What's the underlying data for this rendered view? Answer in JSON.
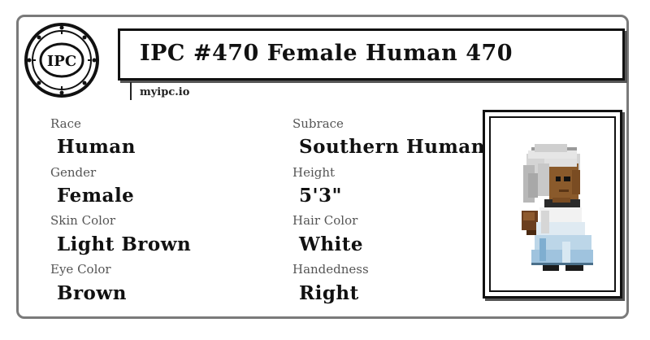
{
  "logo": {
    "text": "IPC",
    "icon": "ipc-coin-logo-icon"
  },
  "title": "IPC #470 Female Human 470",
  "site": "myipc.io",
  "fields": {
    "race": {
      "label": "Race",
      "value": "Human"
    },
    "subrace": {
      "label": "Subrace",
      "value": "Southern Human"
    },
    "gender": {
      "label": "Gender",
      "value": "Female"
    },
    "height": {
      "label": "Height",
      "value": "5'3\""
    },
    "skin_color": {
      "label": "Skin Color",
      "value": "Light Brown"
    },
    "hair_color": {
      "label": "Hair Color",
      "value": "White"
    },
    "eye_color": {
      "label": "Eye Color",
      "value": "Brown"
    },
    "handedness": {
      "label": "Handedness",
      "value": "Right"
    }
  },
  "portrait": {
    "icon": "pixel-character-portrait-icon"
  },
  "colors": {
    "border": "#7a7a7a",
    "text": "#111111",
    "label": "#555555",
    "skin": "#8a5a2b",
    "hair": "#d8d8d8",
    "dress": "#bcd6e8"
  }
}
